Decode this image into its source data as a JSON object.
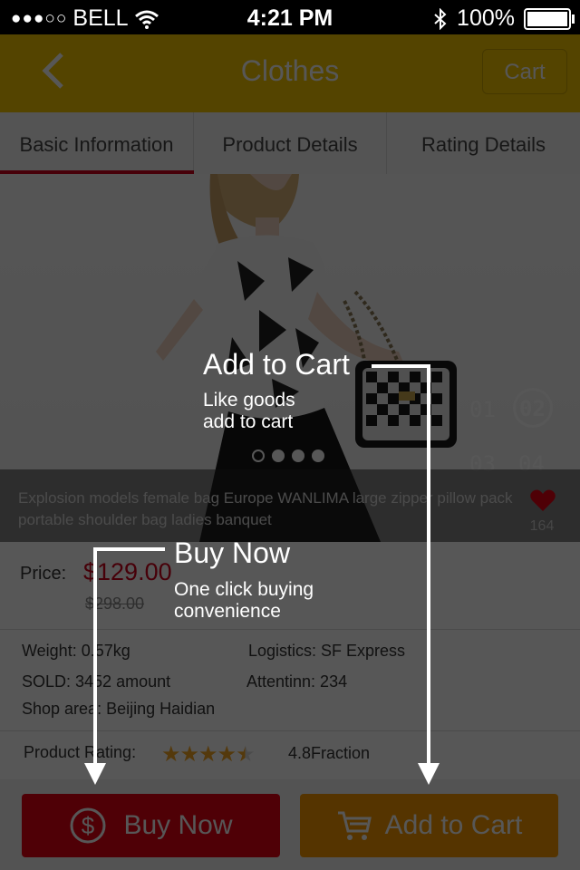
{
  "status_bar": {
    "signal": "●●●○○",
    "carrier": "BELL",
    "time": "4:21 PM",
    "battery": "100%",
    "battery_level": 1.0
  },
  "nav": {
    "title": "Clothes",
    "cart_label": "Cart"
  },
  "tabs": [
    "Basic Information",
    "Product Details",
    "Rating Details"
  ],
  "product": {
    "description": "Explosion models female bag Europe WANLIMA large zipper pillow pack portable shoulder bag ladies banquet",
    "likes": "164",
    "price_label": "Price:",
    "price": "$129.00",
    "original_price": "$298.00",
    "weight": "Weight: 0.57kg",
    "logistics": "Logistics: SF Express",
    "sold": "SOLD: 3452 amount",
    "attention": "Attentinn: 234",
    "shop_area": "Shop area: Beijing Haidian",
    "rating_label": "Product Rating:",
    "rating_value": 4.8,
    "rating_text": "4.8Fraction"
  },
  "slides": {
    "numbers": [
      "01",
      "02",
      "03",
      "04"
    ],
    "active_dot": 0,
    "dot_count": 4
  },
  "actions": {
    "buy_now": "Buy Now",
    "add_to_cart": "Add to Cart"
  },
  "tutorial": {
    "cart_tip_title": "Add to Cart",
    "cart_tip_text": "Like goods add to cart",
    "buy_tip_title": "Buy Now",
    "buy_tip_text": "One click buying convenience"
  },
  "colors": {
    "nav": "#f6c700",
    "buy": "#e60012",
    "cart": "#f89a00",
    "price": "#d0021b",
    "stars": "#f5a623"
  }
}
